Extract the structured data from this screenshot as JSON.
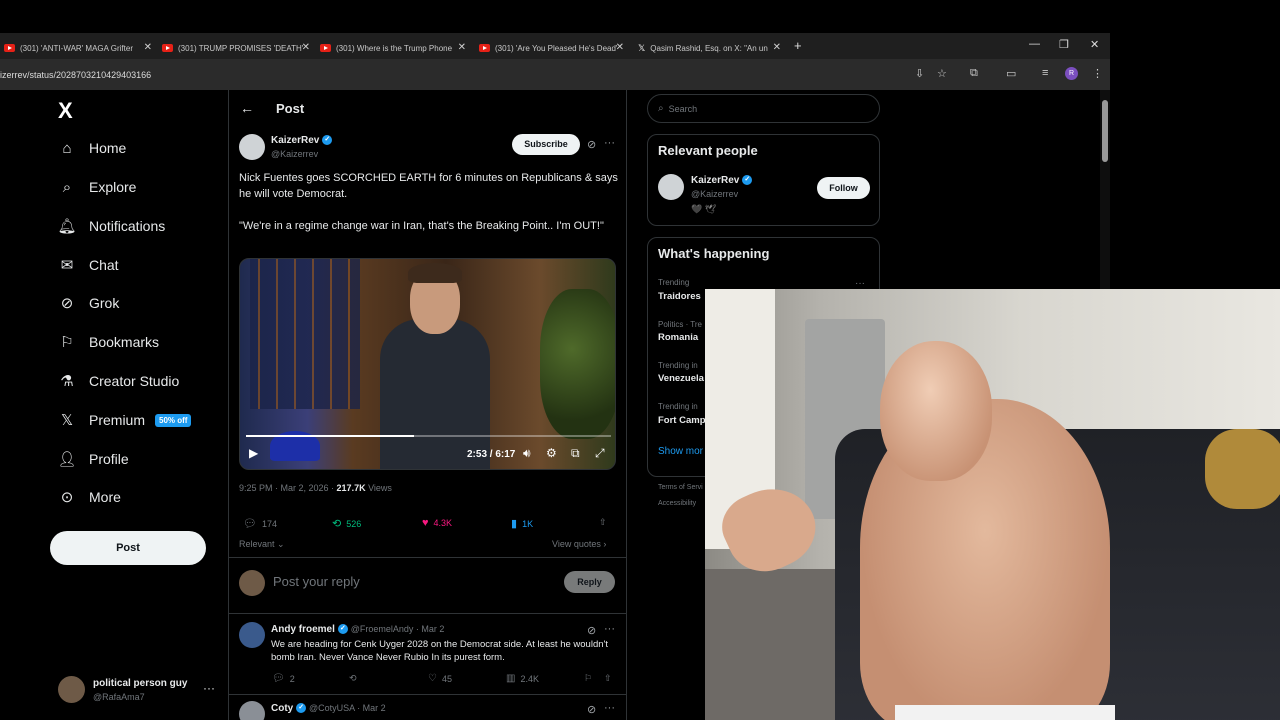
{
  "browser": {
    "tabs": [
      {
        "title": "(301) 'ANTI-WAR' MAGA Grifter",
        "icon": "youtube-icon"
      },
      {
        "title": "(301) TRUMP PROMISES 'DEATH'",
        "icon": "youtube-icon"
      },
      {
        "title": "(301) Where is the Trump Phone",
        "icon": "youtube-icon"
      },
      {
        "title": "(301) 'Are You Pleased He's Dead'",
        "icon": "youtube-icon"
      },
      {
        "title": "Qasim Rashid, Esq. on X: \"An un",
        "icon": "x-logo-icon"
      }
    ],
    "url": "izerrev/status/2028703210429403166",
    "profile_initial": "R"
  },
  "nav": {
    "brand": "X",
    "items": [
      {
        "label": "Home",
        "icon": "home-icon"
      },
      {
        "label": "Explore",
        "icon": "search-icon"
      },
      {
        "label": "Notifications",
        "icon": "bell-icon"
      },
      {
        "label": "Chat",
        "icon": "mail-icon"
      },
      {
        "label": "Grok",
        "icon": "grok-icon"
      },
      {
        "label": "Bookmarks",
        "icon": "bookmark-icon"
      },
      {
        "label": "Creator Studio",
        "icon": "flask-icon"
      },
      {
        "label": "Premium",
        "icon": "x-logo-icon",
        "badge": "50% off"
      },
      {
        "label": "Profile",
        "icon": "person-icon"
      },
      {
        "label": "More",
        "icon": "more-circle-icon"
      }
    ],
    "post_button": "Post",
    "account": {
      "name": "political person guy",
      "handle": "@RafaAma7"
    }
  },
  "post": {
    "header_title": "Post",
    "author": {
      "name": "KaizerRev",
      "handle": "@Kaizerrev"
    },
    "subscribe": "Subscribe",
    "text1": "Nick Fuentes goes SCORCHED EARTH for 6 minutes on Republicans & says he will vote Democrat.",
    "text2": "\"We're in a regime change war in Iran, that's the Breaking Point.. I'm OUT!\"",
    "video": {
      "time": "2:53 / 6:17",
      "progress": 0.46
    },
    "timestamp": "9:25 PM · Mar 2, 2026 · ",
    "views_count": "217.7K",
    "views_label": " Views",
    "stats": {
      "replies": "174",
      "reposts": "526",
      "likes": "4.3K",
      "bookmarks": "1K"
    },
    "sort": "Relevant",
    "view_quotes": "View quotes",
    "reply_placeholder": "Post your reply",
    "reply_button": "Reply"
  },
  "replies": [
    {
      "name": "Andy froemel",
      "handle_date": "@FroemelAndy · Mar 2",
      "text": "We are heading for Cenk Uyger 2028 on the Democrat side. At least he wouldn't bomb Iran. Never Vance Never Rubio In its purest form.",
      "stats": {
        "replies": "2",
        "likes": "45",
        "views": "2.4K"
      }
    },
    {
      "name": "Coty",
      "handle_date": "@CotyUSA · Mar 2"
    }
  ],
  "sidebar": {
    "search_placeholder": "Search",
    "relevant_people_title": "Relevant people",
    "person": {
      "name": "KaizerRev",
      "handle": "@Kaizerrev",
      "follow": "Follow",
      "emoji": "🖤 🕊"
    },
    "whats_happening_title": "What's happening",
    "trends": [
      {
        "context": "Trending",
        "name": "Traidores"
      },
      {
        "context": "Politics · Tre",
        "name": "Romania"
      },
      {
        "context": "Trending in",
        "name": "Venezuela"
      },
      {
        "context": "Trending in",
        "name": "Fort Camp"
      }
    ],
    "show_more": "Show mor",
    "footer": [
      "Terms of Servi",
      "Accessibility"
    ]
  },
  "colors": {
    "accent": "#1d9bf0",
    "like": "#f91880",
    "repost": "#00ba7c"
  }
}
